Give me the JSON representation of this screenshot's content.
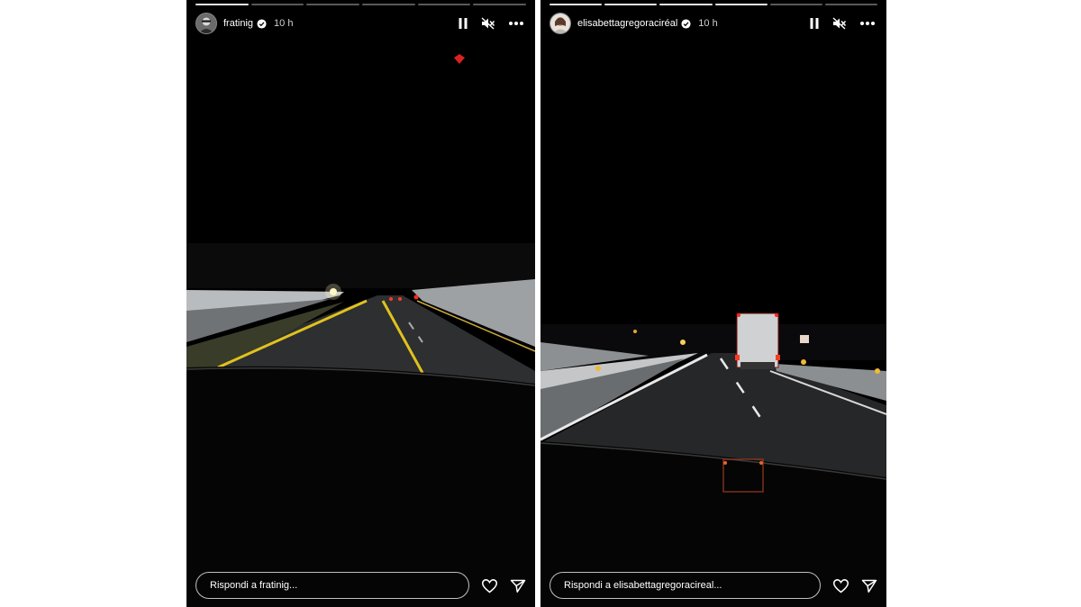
{
  "stories": [
    {
      "username": "fratinig",
      "time": "10 h",
      "reply_placeholder": "Rispondi a fratinig...",
      "progress_done": 1,
      "progress_total": 6
    },
    {
      "username": "elisabettagregoraciréal",
      "time": "10 h",
      "reply_placeholder": "Rispondi a elisabettagregoracireal...",
      "progress_done": 4,
      "progress_total": 6
    }
  ],
  "icons": {
    "pause": "pause-icon",
    "mute": "speaker-muted-icon",
    "more": "more-horizontal-icon",
    "like": "heart-icon",
    "share": "send-icon",
    "verified": "verified-badge-icon"
  },
  "colors": {
    "background": "#000000",
    "text": "#ffffff",
    "verified": "#ffffff"
  }
}
